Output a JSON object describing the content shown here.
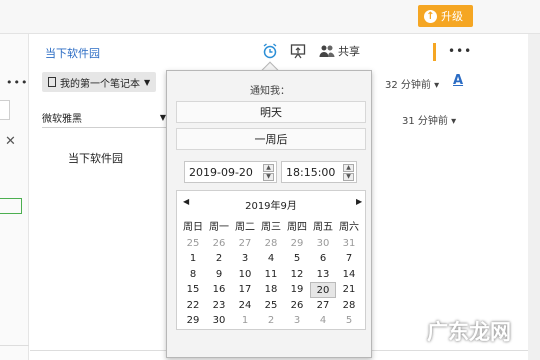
{
  "topbar": {
    "upgrade_label": "升级"
  },
  "note": {
    "title": "当下软件园",
    "notebook_label": "我的第一个笔记本",
    "body_text": "当下软件园"
  },
  "toolbar": {
    "share_label": "共享",
    "time_right_1": "32 分钟前",
    "time_right_2": "31 分钟前",
    "font_name": "微软雅黑",
    "font_color_label": "A"
  },
  "popup": {
    "notify_label": "通知我：",
    "option_tomorrow": "明天",
    "option_week": "一周后",
    "date_value": "2019-09-20",
    "time_value": "18:15:00",
    "calendar_month": "2019年9月",
    "weekdays": [
      "周日",
      "周一",
      "周二",
      "周三",
      "周四",
      "周五",
      "周六"
    ],
    "weeks": [
      [
        "25",
        "26",
        "27",
        "28",
        "29",
        "30",
        "31"
      ],
      [
        "1",
        "2",
        "3",
        "4",
        "5",
        "6",
        "7"
      ],
      [
        "8",
        "9",
        "10",
        "11",
        "12",
        "13",
        "14"
      ],
      [
        "15",
        "16",
        "17",
        "18",
        "19",
        "20",
        "21"
      ],
      [
        "22",
        "23",
        "24",
        "25",
        "26",
        "27",
        "28"
      ],
      [
        "29",
        "30",
        "1",
        "2",
        "3",
        "4",
        "5"
      ]
    ],
    "selected_day": "20"
  },
  "watermark": "广东龙网",
  "colors": {
    "accent_orange": "#f5a623",
    "link_blue": "#2b6cc4"
  }
}
